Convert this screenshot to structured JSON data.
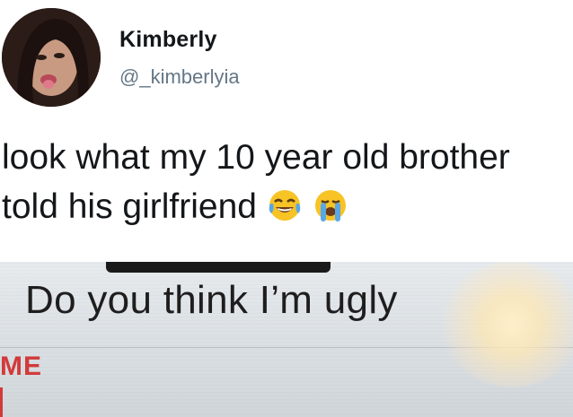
{
  "user": {
    "display_name": "Kimberly",
    "handle": "@_kimberlyia",
    "avatar_icon": "profile-photo"
  },
  "tweet": {
    "text": "look what my 10 year old brother told his girlfriend",
    "emojis": [
      "face-with-tears-of-joy-emoji",
      "loudly-crying-face-emoji"
    ]
  },
  "attached_photo": {
    "message_text": "Do you think I’m ugly",
    "sender_label": "ME",
    "sender_color": "#d23a3a"
  },
  "colors": {
    "name": "#14171a",
    "handle": "#657786",
    "text": "#14171a"
  }
}
